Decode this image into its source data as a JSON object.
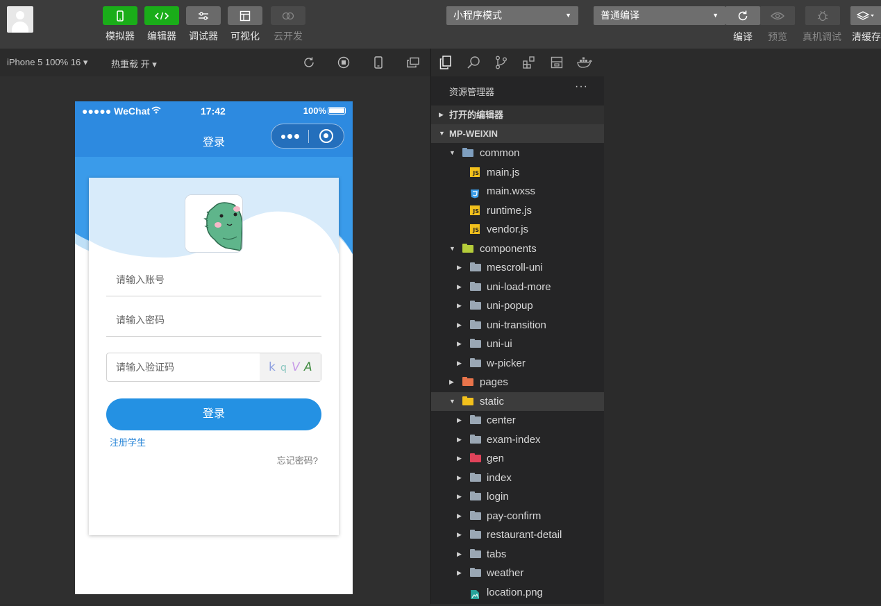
{
  "toolbar": {
    "left_buttons": [
      {
        "label": "模拟器",
        "icon": "phone-icon"
      },
      {
        "label": "编辑器",
        "icon": "code-icon"
      },
      {
        "label": "调试器",
        "icon": "debug-sliders-icon"
      },
      {
        "label": "可视化",
        "icon": "layout-icon"
      },
      {
        "label": "云开发",
        "icon": "cloud-icon"
      }
    ],
    "mode_select": "小程序模式",
    "compile_select": "普通编译",
    "right_buttons": [
      {
        "label": "编译",
        "icon": "refresh-icon"
      },
      {
        "label": "预览",
        "icon": "eye-icon"
      },
      {
        "label": "真机调试",
        "icon": "bug-icon"
      },
      {
        "label": "清缓存",
        "icon": "layers-icon"
      }
    ]
  },
  "simulator": {
    "device": "iPhone 5 100% 16 ▾",
    "hot_reload": "热重载 开 ▾",
    "status_bar": {
      "carrier": "●●●●● WeChat",
      "time": "17:42",
      "battery": "100%"
    },
    "nav_title": "登录",
    "login_form": {
      "account_placeholder": "请输入账号",
      "password_placeholder": "请输入密码",
      "captcha_placeholder": "请输入验证码",
      "captcha_chars": [
        "k",
        "q",
        "V",
        "A"
      ],
      "login_button": "登录",
      "register_link": "注册学生",
      "forgot_link": "忘记密码?"
    }
  },
  "explorer": {
    "title": "资源管理器",
    "more": "···",
    "open_editors": "打开的编辑器",
    "project": "MP-WEIXIN",
    "tree": [
      {
        "name": "common",
        "type": "folder",
        "expanded": true,
        "depth": 1,
        "color": "#7f9fbf"
      },
      {
        "name": "main.js",
        "type": "js",
        "depth": 2
      },
      {
        "name": "main.wxss",
        "type": "css",
        "depth": 2
      },
      {
        "name": "runtime.js",
        "type": "js",
        "depth": 2
      },
      {
        "name": "vendor.js",
        "type": "js",
        "depth": 2
      },
      {
        "name": "components",
        "type": "folder",
        "expanded": true,
        "depth": 1,
        "color": "#b5cd3a"
      },
      {
        "name": "mescroll-uni",
        "type": "folder",
        "expanded": false,
        "depth": 2,
        "color": "#9aa7b4"
      },
      {
        "name": "uni-load-more",
        "type": "folder",
        "expanded": false,
        "depth": 2,
        "color": "#9aa7b4"
      },
      {
        "name": "uni-popup",
        "type": "folder",
        "expanded": false,
        "depth": 2,
        "color": "#9aa7b4"
      },
      {
        "name": "uni-transition",
        "type": "folder",
        "expanded": false,
        "depth": 2,
        "color": "#9aa7b4"
      },
      {
        "name": "uni-ui",
        "type": "folder",
        "expanded": false,
        "depth": 2,
        "color": "#9aa7b4"
      },
      {
        "name": "w-picker",
        "type": "folder",
        "expanded": false,
        "depth": 2,
        "color": "#9aa7b4"
      },
      {
        "name": "pages",
        "type": "folder",
        "expanded": false,
        "depth": 1,
        "color": "#e8744b"
      },
      {
        "name": "static",
        "type": "folder",
        "expanded": true,
        "depth": 1,
        "color": "#f2c01c",
        "selected": true
      },
      {
        "name": "center",
        "type": "folder",
        "expanded": false,
        "depth": 2,
        "color": "#9aa7b4"
      },
      {
        "name": "exam-index",
        "type": "folder",
        "expanded": false,
        "depth": 2,
        "color": "#9aa7b4"
      },
      {
        "name": "gen",
        "type": "folder",
        "expanded": false,
        "depth": 2,
        "color": "#e0435a"
      },
      {
        "name": "index",
        "type": "folder",
        "expanded": false,
        "depth": 2,
        "color": "#9aa7b4"
      },
      {
        "name": "login",
        "type": "folder",
        "expanded": false,
        "depth": 2,
        "color": "#9aa7b4"
      },
      {
        "name": "pay-confirm",
        "type": "folder",
        "expanded": false,
        "depth": 2,
        "color": "#9aa7b4"
      },
      {
        "name": "restaurant-detail",
        "type": "folder",
        "expanded": false,
        "depth": 2,
        "color": "#9aa7b4"
      },
      {
        "name": "tabs",
        "type": "folder",
        "expanded": false,
        "depth": 2,
        "color": "#9aa7b4"
      },
      {
        "name": "weather",
        "type": "folder",
        "expanded": false,
        "depth": 2,
        "color": "#9aa7b4"
      },
      {
        "name": "location.png",
        "type": "image",
        "depth": 2
      }
    ]
  },
  "colors": {
    "brand_green": "#1aad19",
    "primary_blue": "#2491e3",
    "nav_blue": "#2d8ae0"
  }
}
